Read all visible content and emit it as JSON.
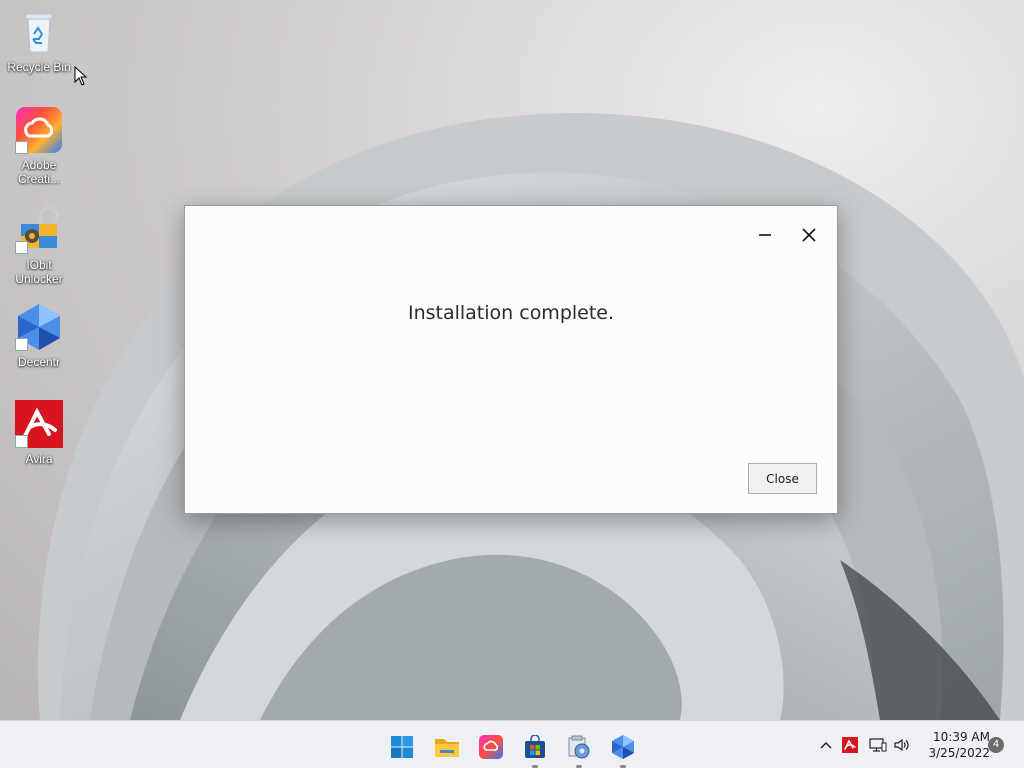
{
  "desktop": {
    "icons": [
      {
        "label": "Recycle Bin",
        "icon": "recycle-bin-icon"
      },
      {
        "label": "Adobe Creati...",
        "icon": "adobe-creative-cloud-icon"
      },
      {
        "label": "IObit Unlocker",
        "icon": "iobit-unlocker-icon"
      },
      {
        "label": "Decentr",
        "icon": "decentr-icon"
      },
      {
        "label": "Avira",
        "icon": "avira-icon"
      }
    ]
  },
  "dialog": {
    "message": "Installation complete.",
    "close_button_label": "Close",
    "minimize_icon": "minimize-icon",
    "close_icon": "close-icon"
  },
  "taskbar": {
    "apps": [
      {
        "name": "start",
        "icon": "windows-start-icon",
        "running": false
      },
      {
        "name": "file-explorer",
        "icon": "folder-icon",
        "running": false
      },
      {
        "name": "adobe-creative-cloud",
        "icon": "adobe-creative-cloud-icon",
        "running": false
      },
      {
        "name": "microsoft-store",
        "icon": "store-icon",
        "running": true
      },
      {
        "name": "installer",
        "icon": "installer-icon",
        "running": true
      },
      {
        "name": "decentr",
        "icon": "decentr-icon",
        "running": true
      }
    ],
    "tray": {
      "overflow_icon": "chevron-up-icon",
      "avira_icon": "avira-icon",
      "network_icon": "network-icon",
      "volume_icon": "volume-icon",
      "time": "10:39 AM",
      "date": "3/25/2022",
      "notification_count": "4"
    }
  },
  "colors": {
    "avira_red": "#d8151f",
    "windows_blue": "#1e8ad6",
    "decentr_blue": "#2f7be0"
  }
}
